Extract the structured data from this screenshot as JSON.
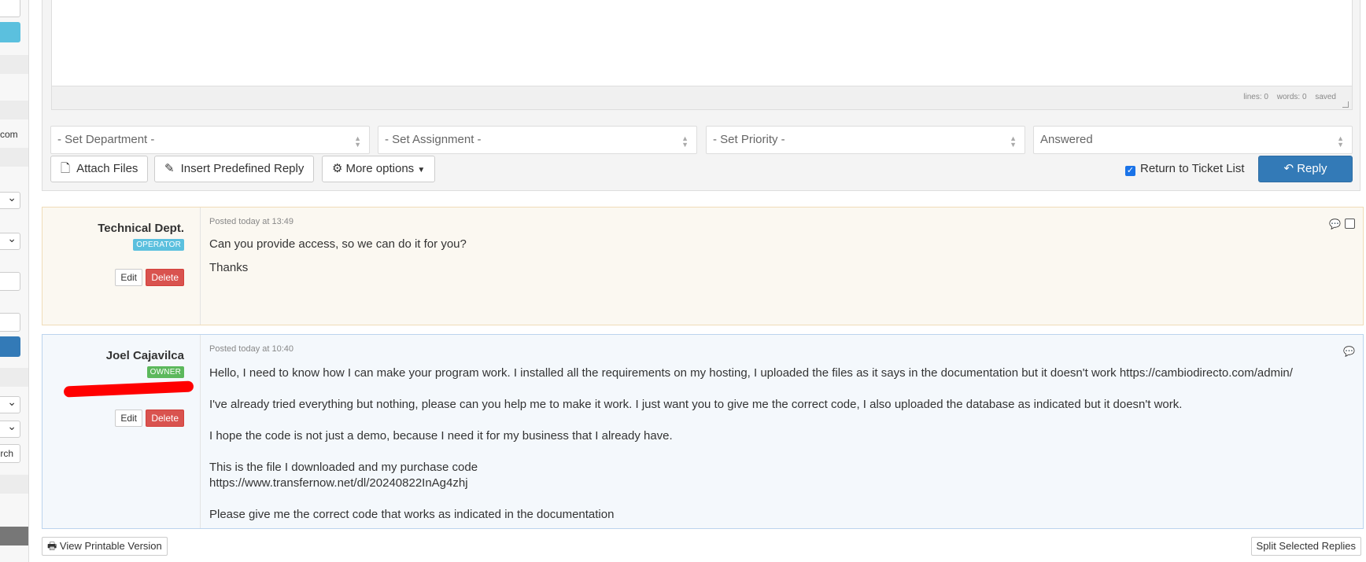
{
  "sidebar": {
    "partial_text_com": "com",
    "partial_button_search": "rch"
  },
  "editor": {
    "stats": {
      "lines": "lines: 0",
      "words": "words: 0",
      "saved": "saved"
    }
  },
  "selects": {
    "department": "- Set Department -",
    "assignment": "- Set Assignment -",
    "priority": "- Set Priority -",
    "status": "Answered"
  },
  "toolbar": {
    "attach_files": "Attach Files",
    "insert_predefined": "Insert Predefined Reply",
    "more_options": "More options",
    "return_to_list": "Return to Ticket List",
    "reply": "Reply"
  },
  "posts": [
    {
      "author": "Technical Dept.",
      "badge": "OPERATOR",
      "posted": "Posted today at 13:49",
      "lines": [
        "Can you provide access, so we can do it for you?",
        "Thanks"
      ],
      "edit": "Edit",
      "delete": "Delete"
    },
    {
      "author": "Joel Cajavilca",
      "badge": "OWNER",
      "posted": "Posted today at 10:40",
      "line1_text": "Hello, I need to know how I can make your program work. I installed all the requirements on my hosting, I uploaded the files as it says in the documentation but it doesn't work",
      "line1_link": "https://cambiodirecto.com/admin/",
      "line2": "I've already tried everything but nothing, please can you help me to make it work. I just want you to give me the correct code, I also uploaded the database as indicated but it doesn't work.",
      "line3": "I hope the code is not just a demo, because I need it for my business that I already have.",
      "line4": "This is the file I downloaded and my purchase code",
      "line5_link": "https://www.transfernow.net/dl/20240822InAg4zhj",
      "line6": "Please give me the correct code that works as indicated in the documentation",
      "edit": "Edit",
      "delete": "Delete"
    }
  ],
  "footer": {
    "printable": "View Printable Version",
    "split": "Split Selected Replies"
  },
  "colors": {
    "primary": "#337ab7",
    "danger": "#d9534f",
    "info": "#5bc0de",
    "success": "#5cb85c",
    "redaction": "#ff0000"
  },
  "icons": {
    "attach": "file-icon",
    "predefined": "pencil-icon",
    "more": "gear-icon",
    "reply": "reply-icon",
    "printable": "print-icon",
    "comment": "comment-icon"
  }
}
